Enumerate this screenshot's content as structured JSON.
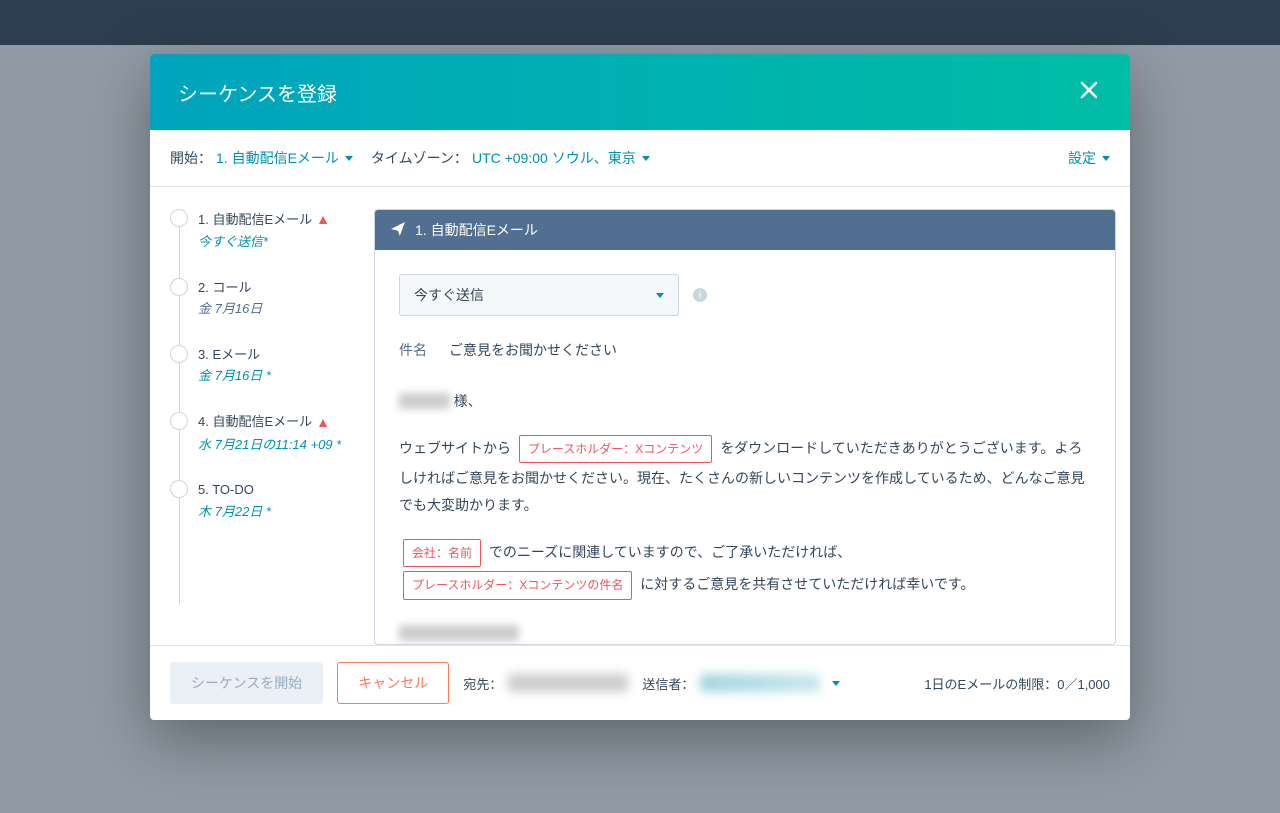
{
  "modal": {
    "title": "シーケンスを登録",
    "start_label": "開始：",
    "start_value": "1. 自動配信Eメール",
    "timezone_label": "タイムゾーン：",
    "timezone_value": "UTC +09:00 ソウル、東京",
    "settings_label": "設定"
  },
  "steps": [
    {
      "title": "1. 自動配信Eメール",
      "sub": "今すぐ送信*",
      "warn": true,
      "sub_link": true
    },
    {
      "title": "2. コール",
      "sub": "金 7月16日",
      "warn": false,
      "sub_link": false
    },
    {
      "title": "3. Eメール",
      "sub": "金 7月16日 *",
      "warn": false,
      "sub_link": true
    },
    {
      "title": "4. 自動配信Eメール",
      "sub": "水 7月21日の11:14 +09 *",
      "warn": true,
      "sub_link": true
    },
    {
      "title": "5. TO-DO",
      "sub": "木 7月22日 *",
      "warn": false,
      "sub_link": true
    }
  ],
  "editor": {
    "header": "1. 自動配信Eメール",
    "send_option": "今すぐ送信",
    "subject_label": "件名",
    "subject_value": "ご意見をお聞かせください",
    "greeting_suffix": "様、",
    "body_part1_before": "ウェブサイトから",
    "token_x_content": "プレースホルダー：Xコンテンツ",
    "body_part1_after": "をダウンロードしていただきありがとうございます。よろしければご意見をお聞かせください。現在、たくさんの新しいコンテンツを作成しているため、どんなご意見でも大変助かります。",
    "token_company": "会社：名前",
    "body_part2_after": "でのニーズに関連していますので、ご了承いただければ、",
    "token_x_subject": "プレースホルダー：Xコンテンツの件名",
    "body_part3_after": "に対するご意見を共有させていただければ幸いです。"
  },
  "footer": {
    "start_button": "シーケンスを開始",
    "cancel_button": "キャンセル",
    "to_label": "宛先：",
    "from_label": "送信者：",
    "limit_label": "1日のEメールの制限：",
    "limit_value": "0／1,000"
  }
}
